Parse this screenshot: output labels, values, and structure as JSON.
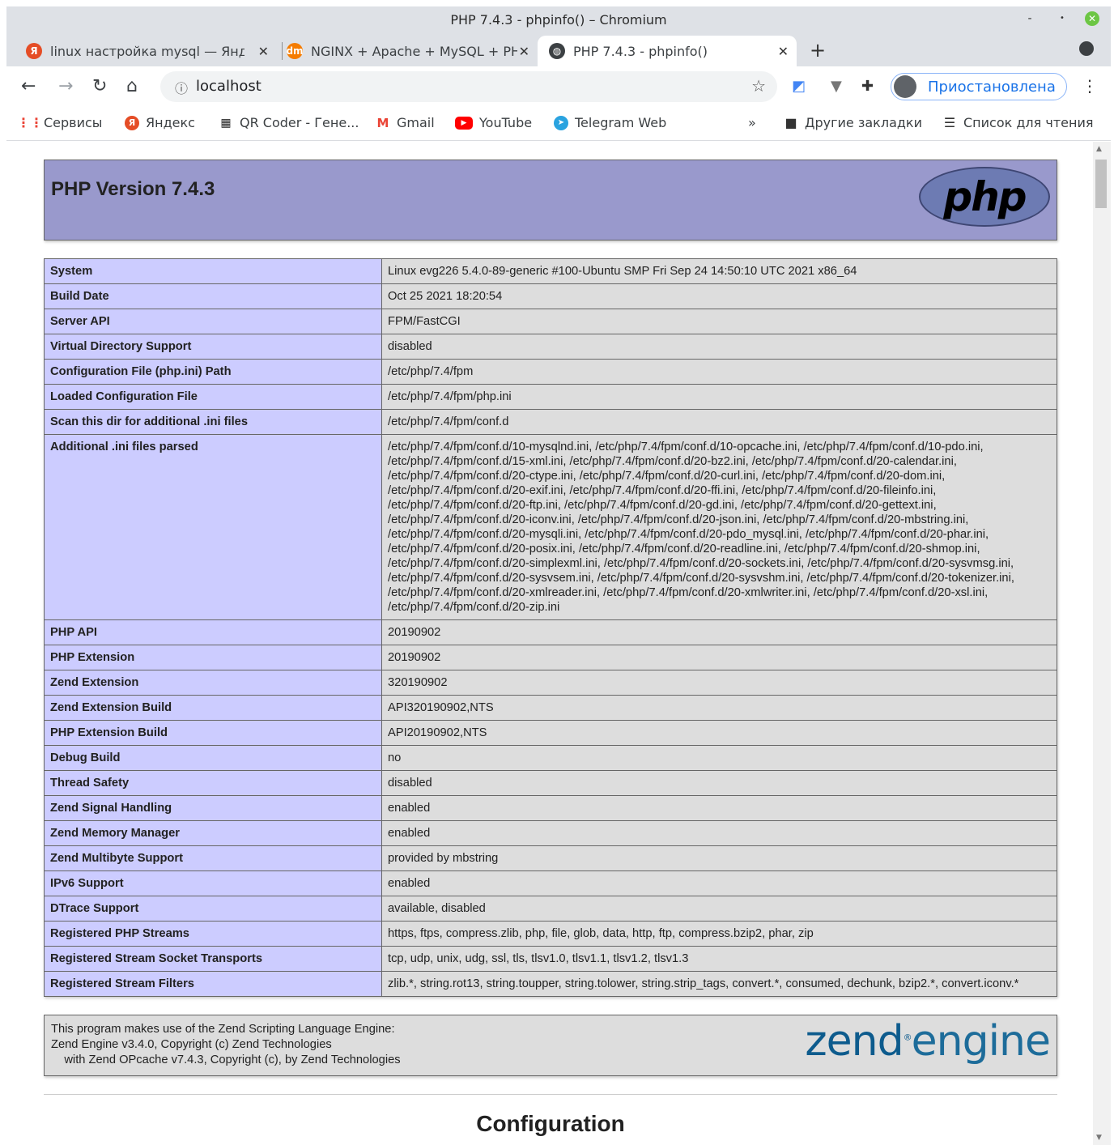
{
  "window": {
    "title": "PHP 7.4.3 - phpinfo() – Chromium",
    "controls": {
      "minimize": "-",
      "maximize": "•",
      "close": "✕"
    }
  },
  "tabs": [
    {
      "label": "linux настройка mysql — Янд",
      "icon_text": "Я",
      "icon_color": "#e54d26",
      "icon": "yandex-icon"
    },
    {
      "label": "NGINX + Apache + MySQL + PH",
      "icon_text": "dm",
      "icon_color": "#f57c00",
      "icon": "dm-icon"
    },
    {
      "label": "PHP 7.4.3 - phpinfo()",
      "icon_text": "◍",
      "icon_color": "#3c4043",
      "icon": "globe-icon",
      "active": true
    }
  ],
  "toolbar": {
    "url": "localhost",
    "profile_label": "Приостановлена"
  },
  "bookmarks": [
    {
      "label": "Сервисы",
      "icon": "apps-grid-icon"
    },
    {
      "label": "Яндекс",
      "icon": "yandex-icon"
    },
    {
      "label": "QR Coder - Гене...",
      "icon": "qr-icon"
    },
    {
      "label": "Gmail",
      "icon": "gmail-icon"
    },
    {
      "label": "YouTube",
      "icon": "youtube-icon"
    },
    {
      "label": "Telegram Web",
      "icon": "telegram-icon"
    },
    {
      "label": "»",
      "icon": "overflow-chevron-icon"
    },
    {
      "label": "Другие закладки",
      "icon": "folder-icon"
    },
    {
      "label": "Список для чтения",
      "icon": "reading-list-icon"
    }
  ],
  "page": {
    "header_title": "PHP Version 7.4.3",
    "logo_text": "php",
    "rows": [
      {
        "key": "System",
        "value": "Linux evg226 5.4.0-89-generic #100-Ubuntu SMP Fri Sep 24 14:50:10 UTC 2021 x86_64"
      },
      {
        "key": "Build Date",
        "value": "Oct 25 2021 18:20:54"
      },
      {
        "key": "Server API",
        "value": "FPM/FastCGI"
      },
      {
        "key": "Virtual Directory Support",
        "value": "disabled"
      },
      {
        "key": "Configuration File (php.ini) Path",
        "value": "/etc/php/7.4/fpm"
      },
      {
        "key": "Loaded Configuration File",
        "value": "/etc/php/7.4/fpm/php.ini"
      },
      {
        "key": "Scan this dir for additional .ini files",
        "value": "/etc/php/7.4/fpm/conf.d"
      },
      {
        "key": "Additional .ini files parsed",
        "value": "/etc/php/7.4/fpm/conf.d/10-mysqlnd.ini, /etc/php/7.4/fpm/conf.d/10-opcache.ini, /etc/php/7.4/fpm/conf.d/10-pdo.ini, /etc/php/7.4/fpm/conf.d/15-xml.ini, /etc/php/7.4/fpm/conf.d/20-bz2.ini, /etc/php/7.4/fpm/conf.d/20-calendar.ini, /etc/php/7.4/fpm/conf.d/20-ctype.ini, /etc/php/7.4/fpm/conf.d/20-curl.ini, /etc/php/7.4/fpm/conf.d/20-dom.ini, /etc/php/7.4/fpm/conf.d/20-exif.ini, /etc/php/7.4/fpm/conf.d/20-ffi.ini, /etc/php/7.4/fpm/conf.d/20-fileinfo.ini, /etc/php/7.4/fpm/conf.d/20-ftp.ini, /etc/php/7.4/fpm/conf.d/20-gd.ini, /etc/php/7.4/fpm/conf.d/20-gettext.ini, /etc/php/7.4/fpm/conf.d/20-iconv.ini, /etc/php/7.4/fpm/conf.d/20-json.ini, /etc/php/7.4/fpm/conf.d/20-mbstring.ini, /etc/php/7.4/fpm/conf.d/20-mysqli.ini, /etc/php/7.4/fpm/conf.d/20-pdo_mysql.ini, /etc/php/7.4/fpm/conf.d/20-phar.ini, /etc/php/7.4/fpm/conf.d/20-posix.ini, /etc/php/7.4/fpm/conf.d/20-readline.ini, /etc/php/7.4/fpm/conf.d/20-shmop.ini, /etc/php/7.4/fpm/conf.d/20-simplexml.ini, /etc/php/7.4/fpm/conf.d/20-sockets.ini, /etc/php/7.4/fpm/conf.d/20-sysvmsg.ini, /etc/php/7.4/fpm/conf.d/20-sysvsem.ini, /etc/php/7.4/fpm/conf.d/20-sysvshm.ini, /etc/php/7.4/fpm/conf.d/20-tokenizer.ini, /etc/php/7.4/fpm/conf.d/20-xmlreader.ini, /etc/php/7.4/fpm/conf.d/20-xmlwriter.ini, /etc/php/7.4/fpm/conf.d/20-xsl.ini, /etc/php/7.4/fpm/conf.d/20-zip.ini"
      },
      {
        "key": "PHP API",
        "value": "20190902"
      },
      {
        "key": "PHP Extension",
        "value": "20190902"
      },
      {
        "key": "Zend Extension",
        "value": "320190902"
      },
      {
        "key": "Zend Extension Build",
        "value": "API320190902,NTS"
      },
      {
        "key": "PHP Extension Build",
        "value": "API20190902,NTS"
      },
      {
        "key": "Debug Build",
        "value": "no"
      },
      {
        "key": "Thread Safety",
        "value": "disabled"
      },
      {
        "key": "Zend Signal Handling",
        "value": "enabled"
      },
      {
        "key": "Zend Memory Manager",
        "value": "enabled"
      },
      {
        "key": "Zend Multibyte Support",
        "value": "provided by mbstring"
      },
      {
        "key": "IPv6 Support",
        "value": "enabled"
      },
      {
        "key": "DTrace Support",
        "value": "available, disabled"
      },
      {
        "key": "Registered PHP Streams",
        "value": "https, ftps, compress.zlib, php, file, glob, data, http, ftp, compress.bzip2, phar, zip"
      },
      {
        "key": "Registered Stream Socket Transports",
        "value": "tcp, udp, unix, udg, ssl, tls, tlsv1.0, tlsv1.1, tlsv1.2, tlsv1.3"
      },
      {
        "key": "Registered Stream Filters",
        "value": "zlib.*, string.rot13, string.toupper, string.tolower, string.strip_tags, convert.*, consumed, dechunk, bzip2.*, convert.iconv.*"
      }
    ],
    "zend_text": "This program makes use of the Zend Scripting Language Engine:\nZend Engine v3.4.0, Copyright (c) Zend Technologies\n    with Zend OPcache v7.4.3, Copyright (c), by Zend Technologies",
    "zend_logo": {
      "zend": "zend",
      "reg": "®",
      "engine": "engine"
    },
    "section_heading": "Configuration"
  },
  "colors": {
    "header_bg": "#9999cc",
    "key_bg": "#ccccff",
    "value_bg": "#dddddd"
  }
}
